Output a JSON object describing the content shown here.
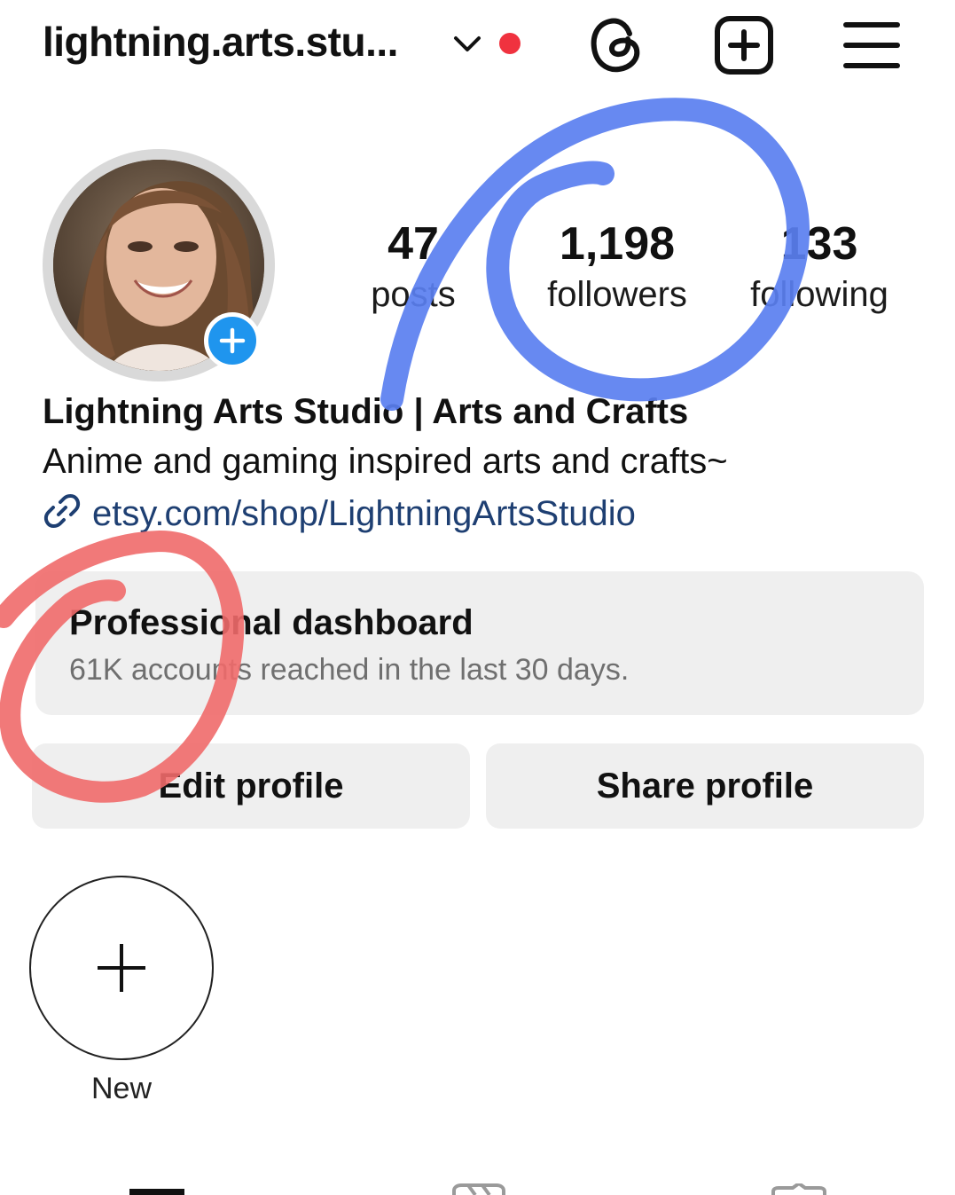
{
  "header": {
    "username": "lightning.arts.stu...",
    "icons": [
      "chevron-down-icon",
      "notification-dot",
      "threads-icon",
      "new-post-icon",
      "menu-icon"
    ],
    "accent_dot_color": "#f0323f"
  },
  "profile": {
    "display_name": "Lightning Arts Studio | Arts and Crafts",
    "bio": "Anime and gaming inspired arts and crafts~",
    "link": "etsy.com/shop/LightningArtsStudio"
  },
  "stats": {
    "posts": {
      "value": "47",
      "label": "posts"
    },
    "followers": {
      "value": "1,198",
      "label": "followers"
    },
    "following": {
      "value": "133",
      "label": "following"
    }
  },
  "dashboard": {
    "title": "Professional dashboard",
    "subtitle": "61K accounts reached in the last 30 days."
  },
  "buttons": {
    "edit": "Edit profile",
    "share": "Share profile"
  },
  "highlights": {
    "new_label": "New"
  },
  "colors": {
    "link": "#1e3f72",
    "add_badge": "#1f95ee",
    "annotation_blue": "#5a7ff0",
    "annotation_red": "#f06a6a"
  }
}
